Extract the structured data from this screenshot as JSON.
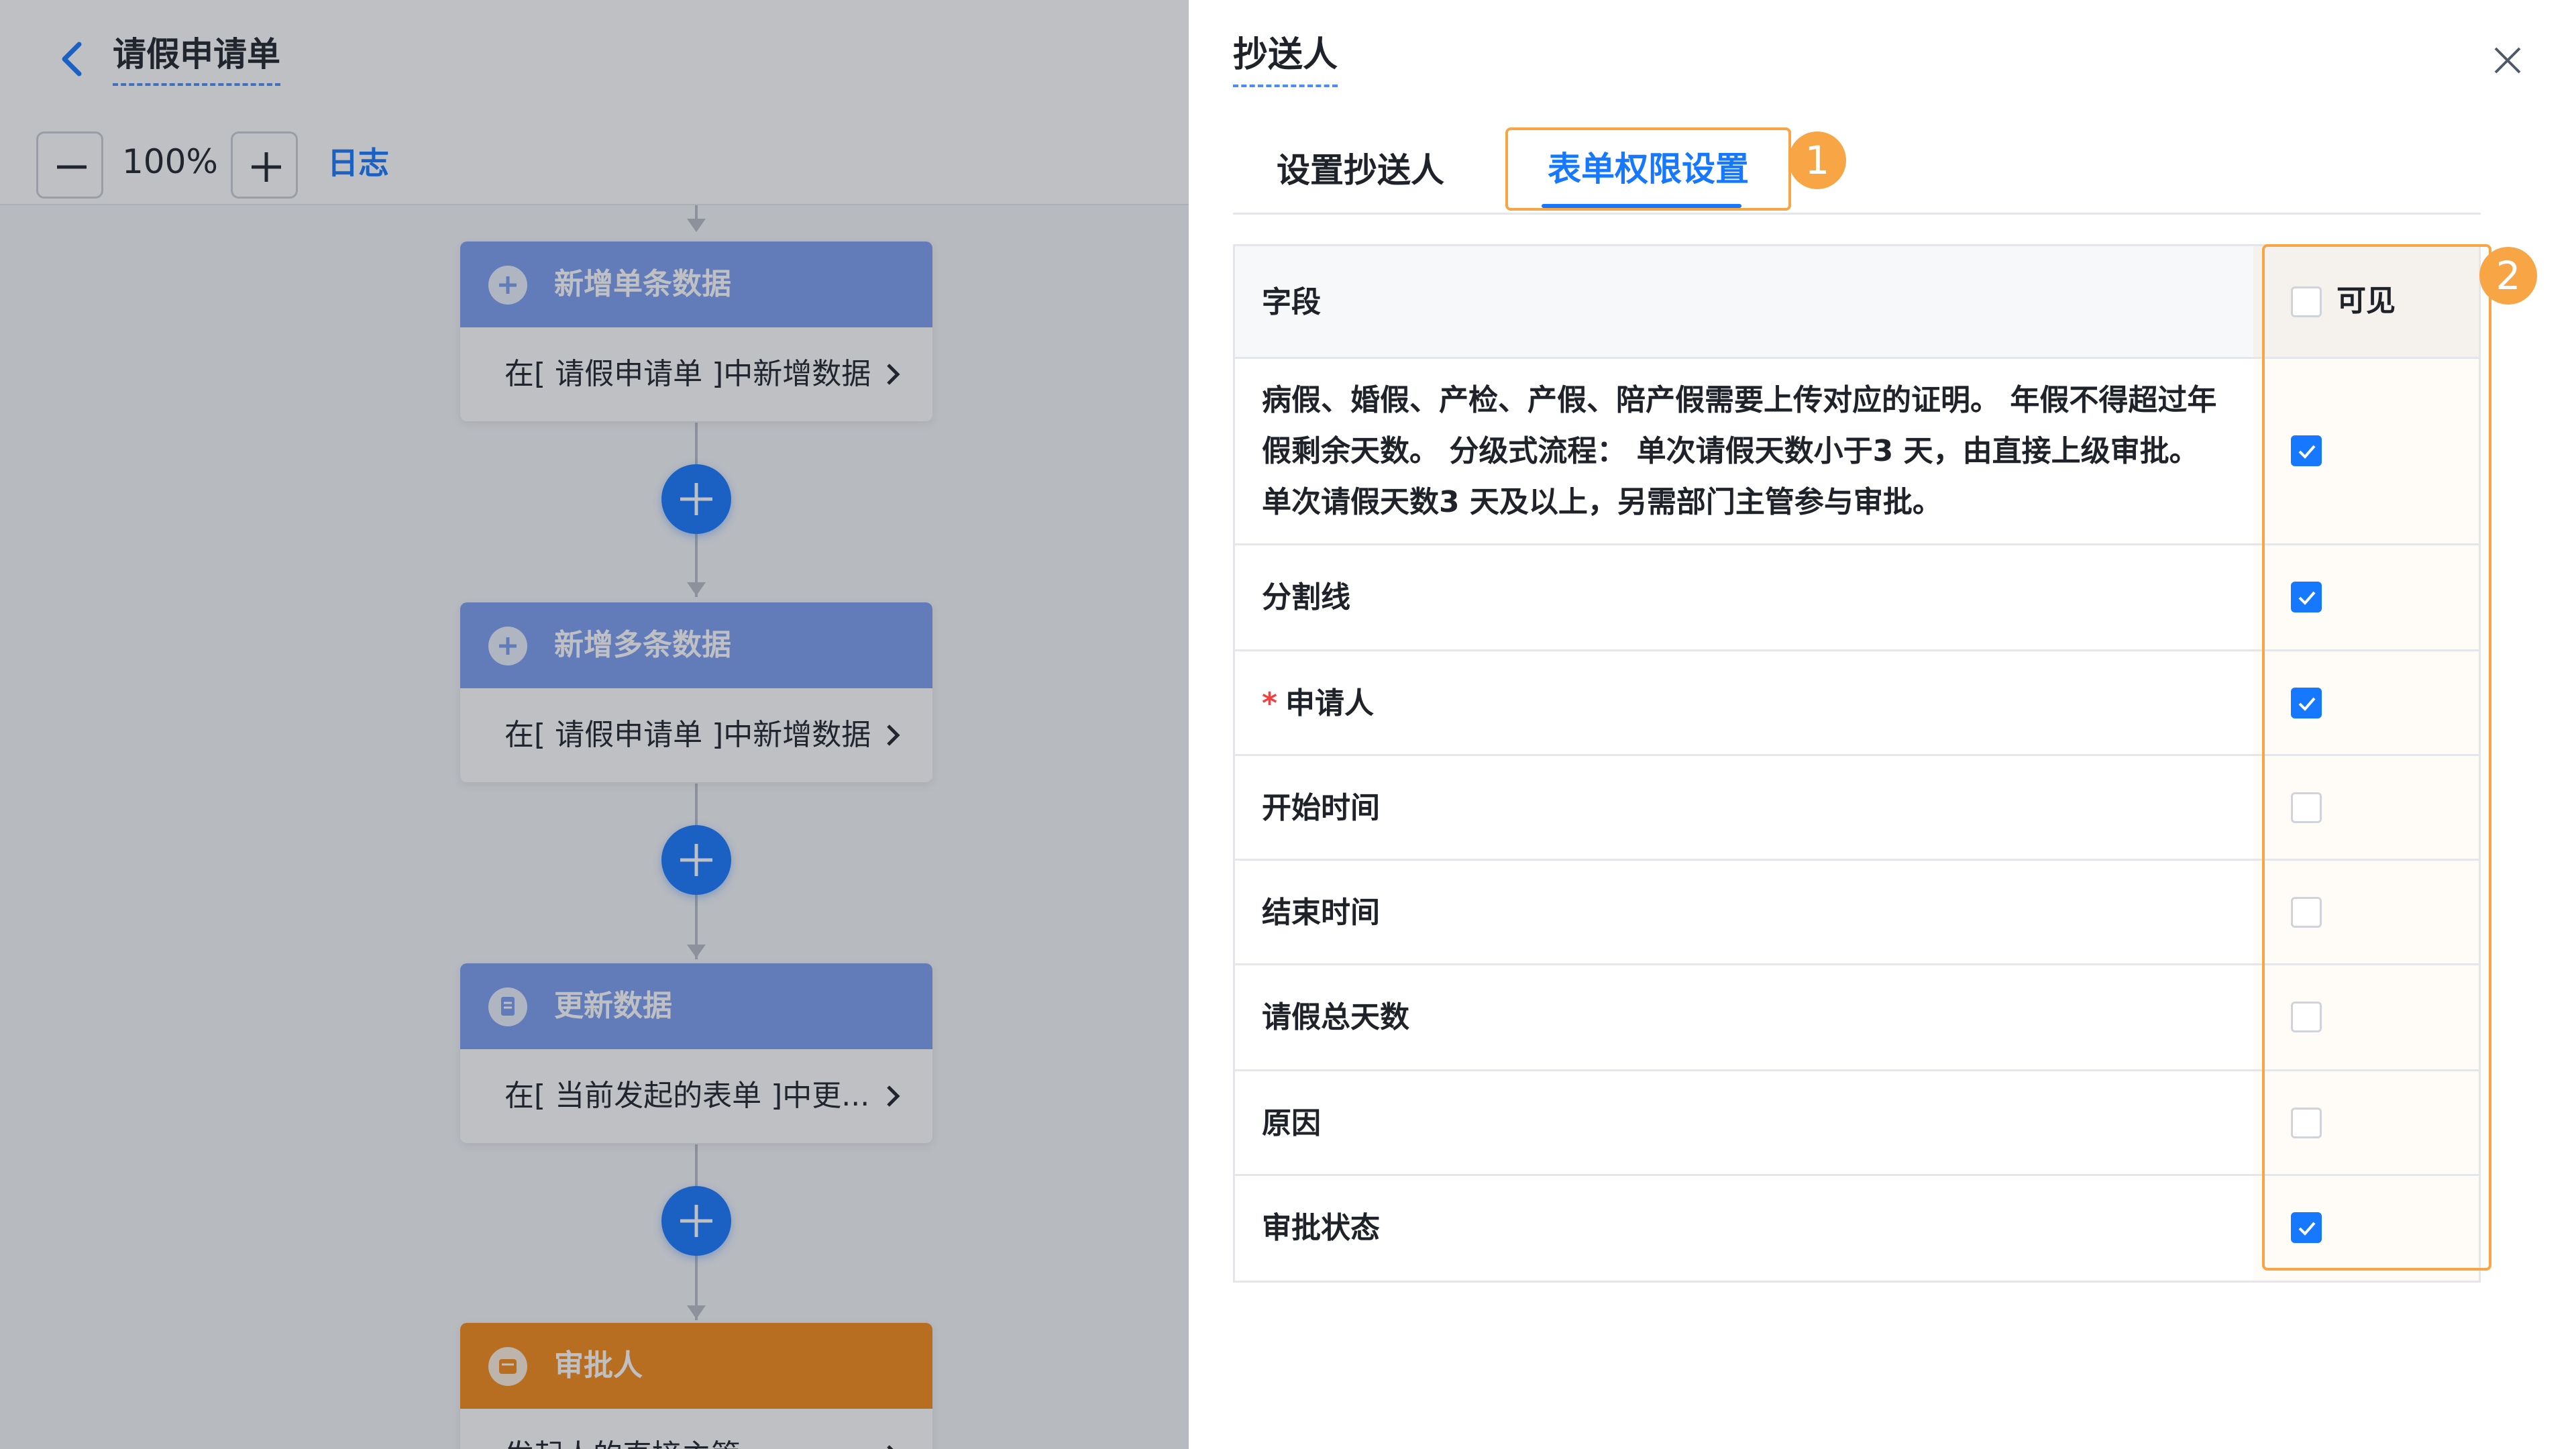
{
  "canvas": {
    "app_title": "请假申请单",
    "zoom": "100%",
    "log_label": "日志",
    "nodes": [
      {
        "title": "新增单条数据",
        "body": "在[ 请假申请单 ]中新增数据",
        "icon": "plus-circle-icon",
        "color": "#7b9cf0"
      },
      {
        "title": "新增多条数据",
        "body": "在[ 请假申请单 ]中新增数据",
        "icon": "plus-circle-icon",
        "color": "#7b9cf0"
      },
      {
        "title": "更新数据",
        "body": "在[ 当前发起的表单 ]中更...",
        "icon": "document-icon",
        "color": "#7b9cf0"
      },
      {
        "title": "审批人",
        "body": "发起人的直接主管",
        "icon": "approver-icon",
        "color": "#f68a15"
      }
    ]
  },
  "drawer": {
    "title": "抄送人",
    "tabs": [
      {
        "label": "设置抄送人",
        "active": false
      },
      {
        "label": "表单权限设置",
        "active": true
      }
    ],
    "badges": [
      "1",
      "2"
    ],
    "table": {
      "header_field": "字段",
      "header_visible": "可见",
      "header_checked": false,
      "rows": [
        {
          "lines": [
            "病假、婚假、产检、产假、陪产假需要上传对应的证明。 年假不得超过年",
            "假剩余天数。 分级式流程： 单次请假天数小于3 天，由直接上级审批。",
            "单次请假天数3 天及以上，另需部门主管参与审批。"
          ],
          "visible": true,
          "required": false
        },
        {
          "lines": [
            "分割线"
          ],
          "visible": true,
          "required": false
        },
        {
          "lines": [
            "申请人"
          ],
          "visible": true,
          "required": true
        },
        {
          "lines": [
            "开始时间"
          ],
          "visible": false,
          "required": false
        },
        {
          "lines": [
            "结束时间"
          ],
          "visible": false,
          "required": false
        },
        {
          "lines": [
            "请假总天数"
          ],
          "visible": false,
          "required": false
        },
        {
          "lines": [
            "原因"
          ],
          "visible": false,
          "required": false
        },
        {
          "lines": [
            "审批状态"
          ],
          "visible": true,
          "required": false
        }
      ]
    }
  },
  "colors": {
    "primary": "#1677ff",
    "highlight": "#f7a545",
    "node_blue": "#7b9cf0",
    "node_orange": "#f68a15",
    "required": "#f53f3f"
  }
}
